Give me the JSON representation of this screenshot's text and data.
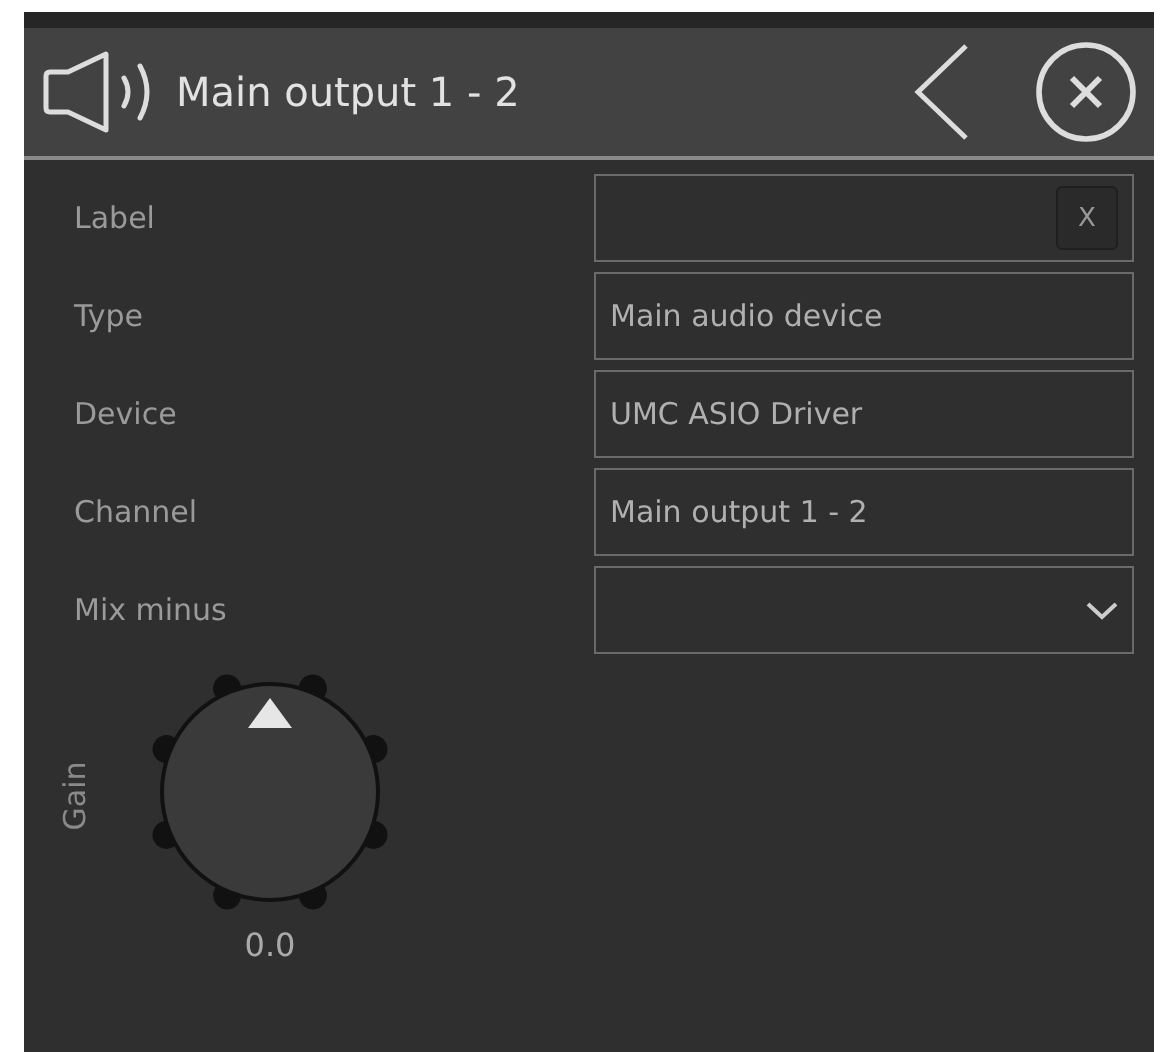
{
  "header": {
    "title": "Main output 1 - 2"
  },
  "fields": [
    {
      "label": "Label",
      "kind": "clearable",
      "clear": "X"
    },
    {
      "label": "Type",
      "kind": "text",
      "value": "Main audio device"
    },
    {
      "label": "Device",
      "kind": "text",
      "value": "UMC ASIO Driver"
    },
    {
      "label": "Channel",
      "kind": "text",
      "value": "Main output 1 - 2"
    },
    {
      "label": "Mix minus",
      "kind": "dropdown"
    }
  ],
  "gain": {
    "label": "Gain",
    "reading": "0.0"
  }
}
